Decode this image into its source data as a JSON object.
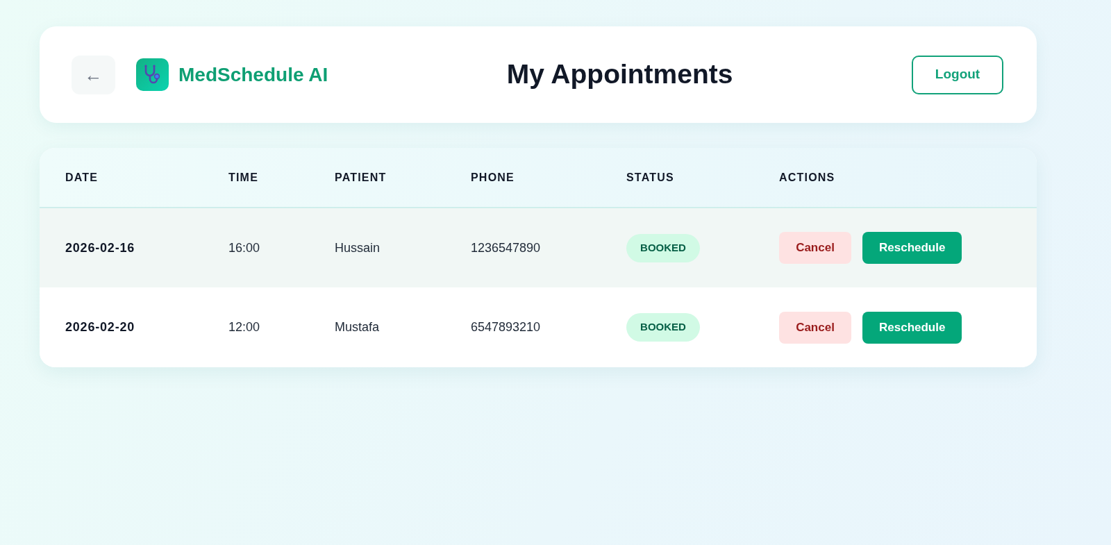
{
  "header": {
    "back_button": "←",
    "brand": "MedSchedule AI",
    "title": "My Appointments",
    "logout_button": "Logout"
  },
  "table": {
    "columns": [
      "DATE",
      "TIME",
      "PATIENT",
      "PHONE",
      "STATUS",
      "ACTIONS"
    ],
    "rows": [
      {
        "highlighted": true,
        "date": "2026-02-16",
        "time": "16:00",
        "patient": "Hussain",
        "phone": "1236547890",
        "status": "BOOKED",
        "actions": [
          {
            "label": "Cancel",
            "kind": "danger"
          },
          {
            "label": "Reschedule",
            "kind": "primary"
          }
        ]
      },
      {
        "highlighted": false,
        "date": "2026-02-20",
        "time": "12:00",
        "patient": "Mustafa",
        "phone": "6547893210",
        "status": "BOOKED",
        "actions": [
          {
            "label": "Cancel",
            "kind": "danger"
          },
          {
            "label": "Reschedule",
            "kind": "primary"
          }
        ]
      }
    ]
  }
}
